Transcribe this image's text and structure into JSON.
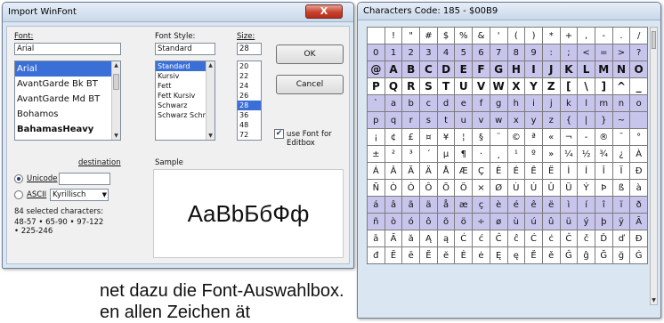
{
  "dialog": {
    "title": "Import WinFont",
    "close_label": "X",
    "font": {
      "label": "Font:",
      "value": "Arial",
      "items": [
        "Arial",
        "AvantGarde Bk BT",
        "AvantGarde Md BT",
        "Bohamos",
        "BahamasHeavy"
      ],
      "selected_index": 0
    },
    "font_style": {
      "label": "Font Style:",
      "value": "Standard",
      "items": [
        "Standard",
        "Kursiv",
        "Fett",
        "Fett Kursiv",
        "Schwarz",
        "Schwarz Schrä"
      ],
      "selected_index": 0
    },
    "size": {
      "label": "Size:",
      "value": "28",
      "items": [
        "20",
        "22",
        "24",
        "26",
        "28",
        "36",
        "48",
        "72"
      ],
      "selected_index": 4
    },
    "ok_label": "OK",
    "cancel_label": "Cancel",
    "use_font_label": "use Font for Editbox",
    "use_font_checked": true,
    "destination_label": "destination",
    "unicode_label": "Unicode",
    "ascii_label": "ASCII",
    "codepage_value": "Kyrillisch",
    "selected_chars_label": "84 selected characters:",
    "selected_ranges": "48-57 • 65-90 • 97-122 • 225-246",
    "sample_label": "Sample",
    "sample_text": "AaBbБбФф"
  },
  "charmap": {
    "title": "Characters  Code: 185 - $00B9",
    "rows": [
      [
        " ",
        "!",
        "\"",
        "#",
        "$",
        "%",
        "&",
        "'",
        "(",
        ")",
        "*",
        "+",
        ",",
        "-",
        ".",
        "/"
      ],
      [
        "0",
        "1",
        "2",
        "3",
        "4",
        "5",
        "6",
        "7",
        "8",
        "9",
        ":",
        ";",
        "<",
        "=",
        ">",
        "?"
      ],
      [
        "@",
        "A",
        "B",
        "C",
        "D",
        "E",
        "F",
        "G",
        "H",
        "I",
        "J",
        "K",
        "L",
        "M",
        "N",
        "O"
      ],
      [
        "P",
        "Q",
        "R",
        "S",
        "T",
        "U",
        "V",
        "W",
        "X",
        "Y",
        "Z",
        "[",
        "\\",
        "]",
        "^",
        "_"
      ],
      [
        "`",
        "a",
        "b",
        "c",
        "d",
        "e",
        "f",
        "g",
        "h",
        "i",
        "j",
        "k",
        "l",
        "m",
        "n",
        "o"
      ],
      [
        "p",
        "q",
        "r",
        "s",
        "t",
        "u",
        "v",
        "w",
        "x",
        "y",
        "z",
        "{",
        "|",
        "}",
        "~",
        ""
      ],
      [
        "¡",
        "¢",
        "£",
        "¤",
        "¥",
        "¦",
        "§",
        "¨",
        "©",
        "ª",
        "«",
        "¬",
        "-",
        "®",
        "¯",
        "°"
      ],
      [
        "±",
        "²",
        "³",
        "´",
        "µ",
        "¶",
        "·",
        "¸",
        "¹",
        "º",
        "»",
        "¼",
        "½",
        "¾",
        "¿",
        "À"
      ],
      [
        "Á",
        "Â",
        "Ã",
        "Ä",
        "Å",
        "Æ",
        "Ç",
        "È",
        "É",
        "Ê",
        "Ë",
        "Ì",
        "Í",
        "Î",
        "Ï",
        "Ð"
      ],
      [
        "Ñ",
        "Ò",
        "Ó",
        "Ô",
        "Õ",
        "Ö",
        "×",
        "Ø",
        "Ù",
        "Ú",
        "Û",
        "Ü",
        "Ý",
        "Þ",
        "ß",
        "à"
      ],
      [
        "á",
        "â",
        "ã",
        "ä",
        "å",
        "æ",
        "ç",
        "è",
        "é",
        "ê",
        "ë",
        "ì",
        "í",
        "î",
        "ï",
        "ð"
      ],
      [
        "ñ",
        "ò",
        "ó",
        "ô",
        "õ",
        "ö",
        "÷",
        "ø",
        "ù",
        "ú",
        "û",
        "ü",
        "ý",
        "þ",
        "ÿ",
        "Ā"
      ],
      [
        "ā",
        "Ă",
        "ă",
        "Ą",
        "ą",
        "Ć",
        "ć",
        "Ĉ",
        "ĉ",
        "Ċ",
        "ċ",
        "Č",
        "č",
        "Ď",
        "ď",
        "Đ"
      ],
      [
        "đ",
        "Ē",
        "ē",
        "Ĕ",
        "ĕ",
        "Ė",
        "ė",
        "Ę",
        "ę",
        "Ě",
        "ě",
        "Ĝ",
        "ĝ",
        "Ğ",
        "ğ",
        "Ġ"
      ]
    ],
    "highlighted_rows": [
      1,
      2,
      4,
      5,
      10,
      11
    ]
  },
  "background": {
    "line1": "net dazu die Font-Auswahlbox.",
    "line2": "en         allen    Zeichen   ät"
  }
}
